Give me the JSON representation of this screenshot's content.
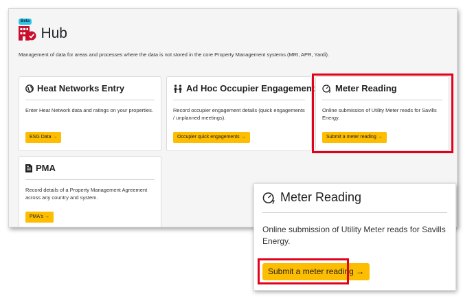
{
  "header": {
    "badge": "Beta",
    "title": "Hub"
  },
  "intro": "Management of data for areas and processes where the data is not stored in the core Property Management systems (MRI, APR, Yardi).",
  "cards": [
    {
      "title": "Heat Networks Entry",
      "icon": "globe-icon",
      "text": "Enter Heat Network data and ratings on your properties.",
      "button": "ESG Data →"
    },
    {
      "title": "Ad Hoc Occupier Engagements",
      "icon": "people-icon",
      "text": "Record occupier engagement details (quick engagements / unplanned meetings).",
      "button": "Occupier quick engagements →"
    },
    {
      "title": "Meter Reading",
      "icon": "meter-icon",
      "text": "Online submission of Utility Meter reads for Savills Energy.",
      "button": "Submit a meter reading →"
    },
    {
      "title": "PMA",
      "icon": "document-icon",
      "text": "Record details of a Property Management Agreement across any country and system.",
      "button": "PMA's →"
    }
  ],
  "zoom": {
    "title": "Meter Reading",
    "text": "Online submission of Utility Meter reads for Savills Energy.",
    "button": "Submit a meter reading →"
  },
  "colors": {
    "accent": "#fdbd00",
    "highlight": "#e3001b",
    "beta": "#2ec4e6",
    "brand": "#c8102e"
  }
}
